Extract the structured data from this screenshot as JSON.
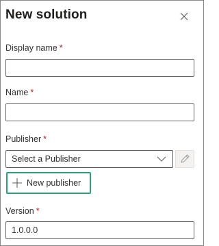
{
  "panel": {
    "title": "New solution",
    "close_icon": "close-icon"
  },
  "fields": {
    "display_name": {
      "label": "Display name",
      "required_mark": "*",
      "value": ""
    },
    "name": {
      "label": "Name",
      "required_mark": "*",
      "value": ""
    },
    "publisher": {
      "label": "Publisher",
      "required_mark": "*",
      "selected": "Select a Publisher",
      "dropdown_icon": "chevron-down-icon",
      "edit_icon": "pencil-icon",
      "new_publisher_label": "New publisher",
      "new_publisher_icon": "plus-icon"
    },
    "version": {
      "label": "Version",
      "required_mark": "*",
      "value": "1.0.0.0"
    }
  },
  "colors": {
    "required": "#a4262c",
    "highlight_border": "#2d9d78",
    "input_border": "#605e5c"
  }
}
